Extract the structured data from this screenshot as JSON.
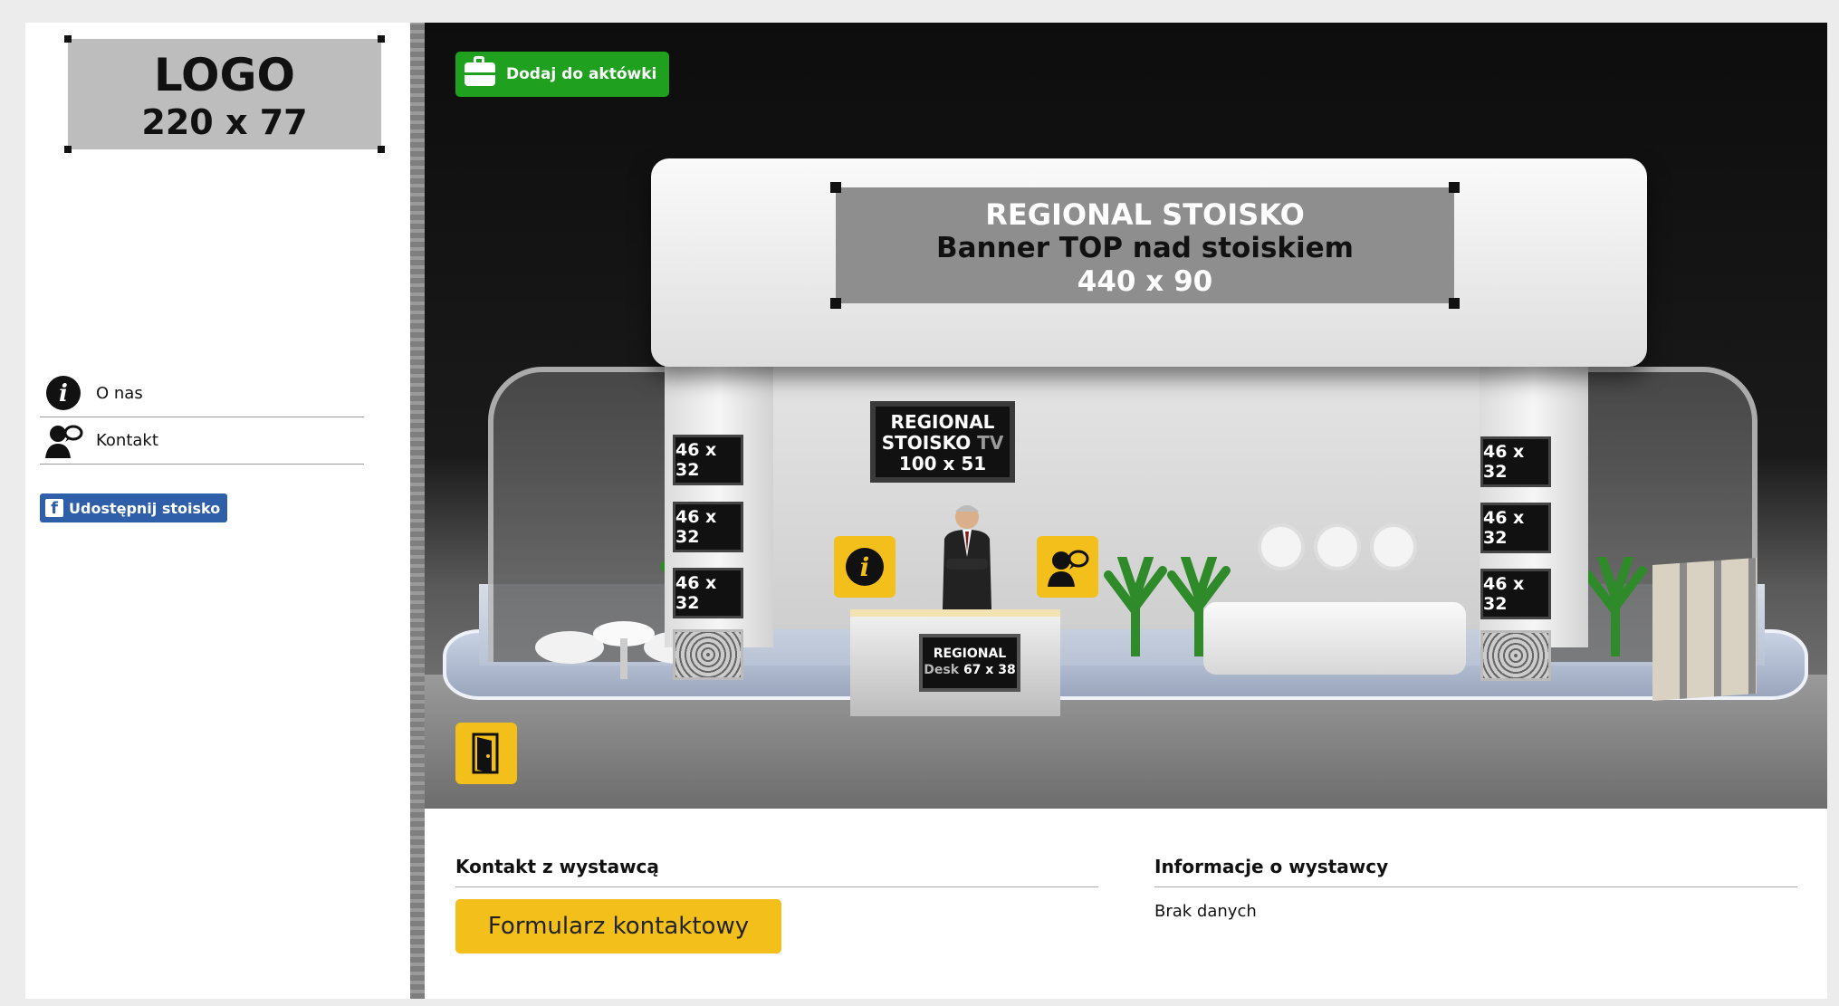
{
  "sidebar": {
    "logo": {
      "line1": "LOGO",
      "line2": "220 x 77"
    },
    "nav": [
      {
        "label": "O nas",
        "icon": "info-icon"
      },
      {
        "label": "Kontakt",
        "icon": "contact-person-icon"
      }
    ],
    "share_label": "Udostępnij stoisko"
  },
  "booth": {
    "add_to_briefcase": "Dodaj do aktówki",
    "banner": {
      "line1": "REGIONAL STOISKO",
      "line2": "Banner TOP nad stoiskiem",
      "line3": "440 x 90"
    },
    "tv": {
      "line1": "REGIONAL",
      "line2a": "STOISKO",
      "line2b": "TV",
      "line3": "100 x 51"
    },
    "side_panel_label": "46 x 32",
    "desk": {
      "line1": "REGIONAL",
      "line2a": "Desk",
      "line2b": "67 x 38"
    }
  },
  "bottom": {
    "contact_title": "Kontakt z wystawcą",
    "contact_form_button": "Formularz kontaktowy",
    "info_title": "Informacje o wystawcy",
    "info_text": "Brak danych"
  },
  "colors": {
    "accent_yellow": "#f3bf1a",
    "green": "#1fa01f",
    "facebook": "#2f5fa8"
  }
}
